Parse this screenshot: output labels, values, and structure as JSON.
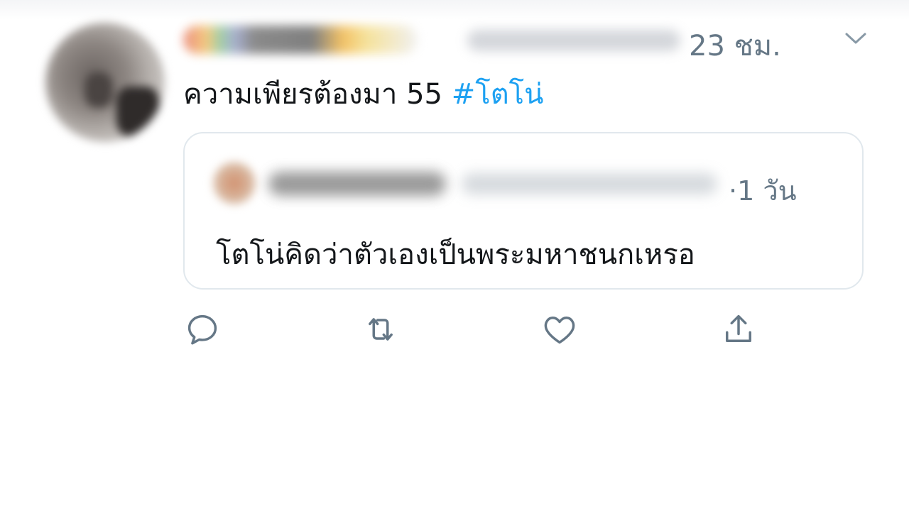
{
  "tweet": {
    "timestamp": "23 ชม.",
    "text": "ความเพียรต้องมา 55",
    "hashtag": "#โตโน่"
  },
  "quoted_tweet": {
    "timestamp": "·1 วัน",
    "text": "โตโน่คิดว่าตัวเองเป็นพระมหาชนกเหรอ"
  },
  "actions": {
    "icons": [
      "reply-icon",
      "retweet-icon",
      "like-icon",
      "share-icon"
    ]
  },
  "colors": {
    "accent": "#1da1f2",
    "secondary_text": "#657786",
    "border": "#e1e8ed"
  }
}
